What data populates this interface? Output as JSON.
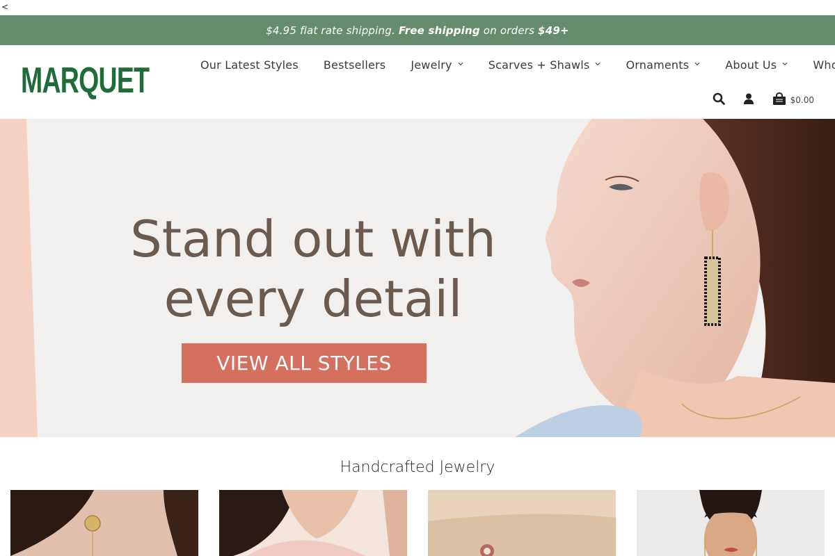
{
  "stray_char": "<",
  "announcement": {
    "part1": "$4.95 flat rate shipping. ",
    "part2": "Free shipping",
    "part3": " on orders ",
    "part4": "$49+"
  },
  "brand": {
    "logo_text": "MARQUET",
    "green": "#1f6b3a",
    "bar_color": "#658c6e"
  },
  "nav": {
    "items": [
      {
        "label": "Our Latest Styles",
        "dropdown": false
      },
      {
        "label": "Bestsellers",
        "dropdown": false
      },
      {
        "label": "Jewelry",
        "dropdown": true
      },
      {
        "label": "Scarves + Shawls",
        "dropdown": true
      },
      {
        "label": "Ornaments",
        "dropdown": true
      },
      {
        "label": "About Us",
        "dropdown": true
      },
      {
        "label": "Wholesale",
        "dropdown": false
      }
    ]
  },
  "utilities": {
    "search_icon": "search-icon",
    "account_icon": "user-icon",
    "cart_icon": "shopping-bag-icon",
    "cart_total": "$0.00"
  },
  "hero": {
    "headline_line1": "Stand out with",
    "headline_line2": "every detail",
    "cta_label": "VIEW ALL STYLES",
    "cta_color": "#d4705f",
    "text_color": "#6b5a50"
  },
  "section": {
    "title": "Handcrafted Jewelry"
  },
  "products": [
    {
      "image": "model-wearing-gold-disc-earring"
    },
    {
      "image": "model-wearing-necklace-pink-top"
    },
    {
      "image": "wrist-with-bracelet-beige"
    },
    {
      "image": "model-wearing-drop-earrings"
    }
  ]
}
